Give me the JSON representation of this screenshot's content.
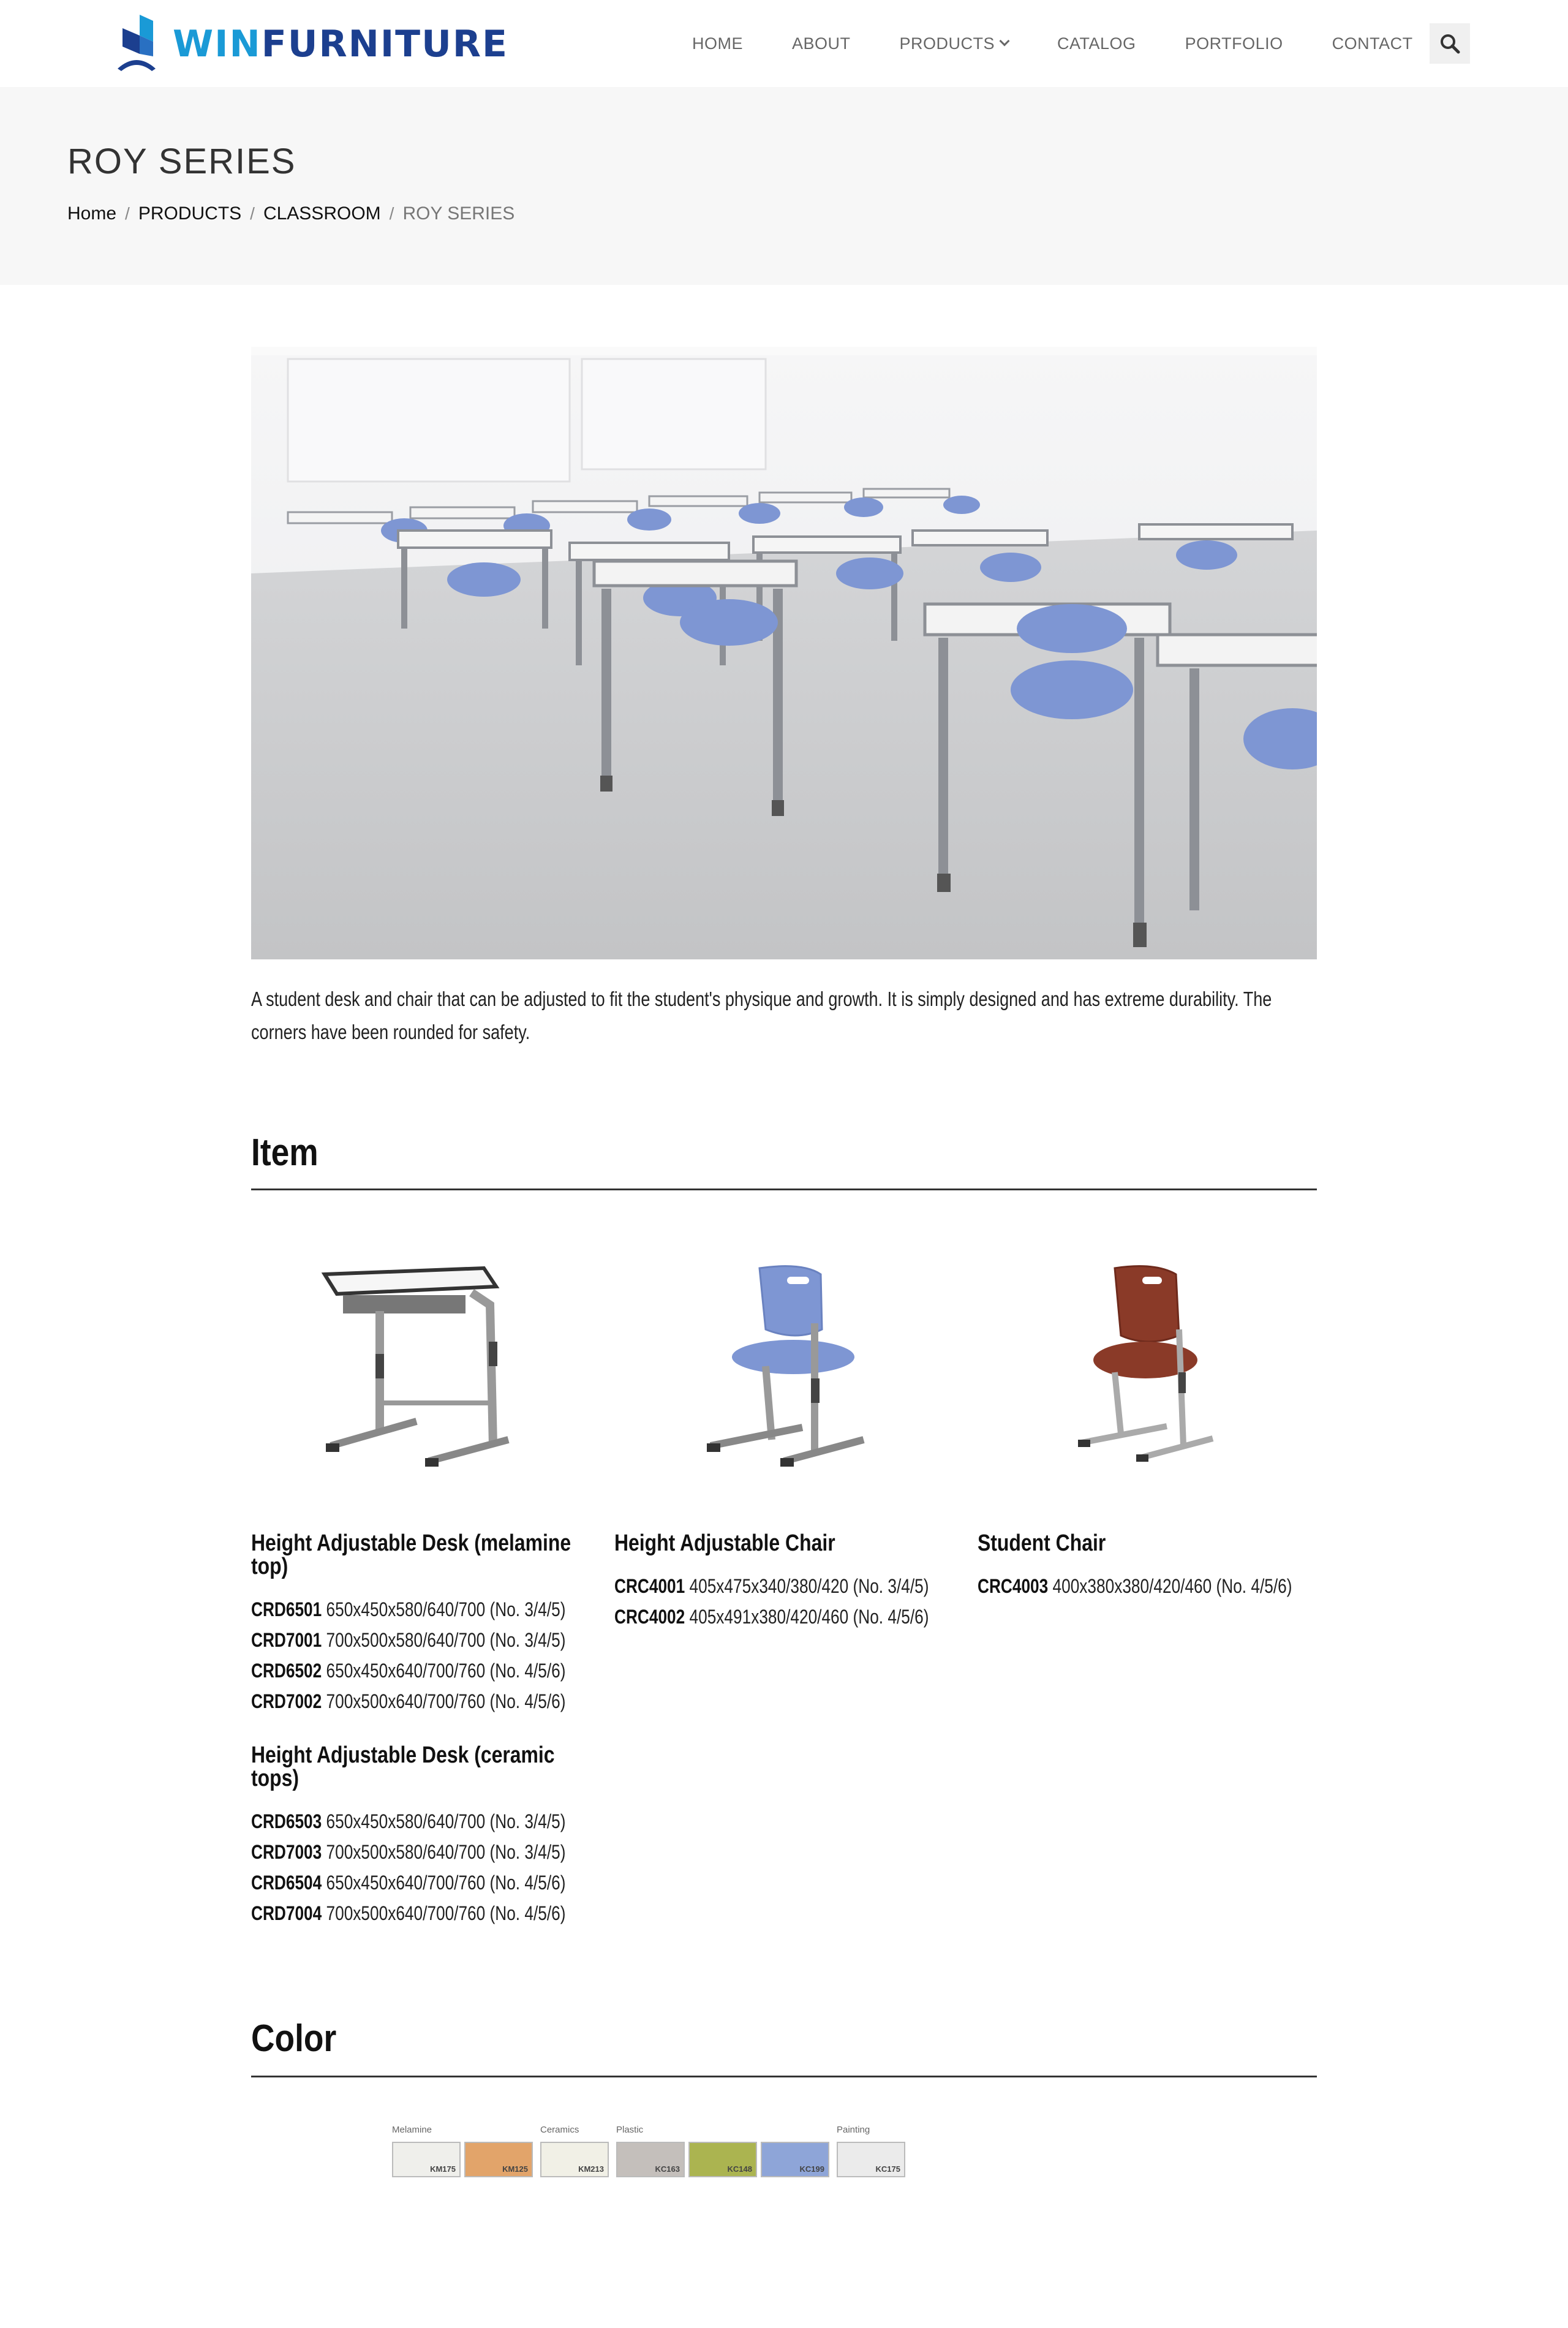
{
  "brand": {
    "name_part1": "WIN",
    "name_part2": "FURNITURE"
  },
  "nav": {
    "items": [
      {
        "label": "HOME"
      },
      {
        "label": "ABOUT"
      },
      {
        "label": "PRODUCTS",
        "has_dropdown": true
      },
      {
        "label": "CATALOG"
      },
      {
        "label": "PORTFOLIO"
      },
      {
        "label": "CONTACT"
      }
    ],
    "search_icon": "search-icon"
  },
  "page": {
    "title": "ROY SERIES",
    "breadcrumb": [
      "Home",
      "PRODUCTS",
      "CLASSROOM",
      "ROY SERIES"
    ]
  },
  "description": "A student desk and chair that can be adjusted to fit the student's physique and growth. It is simply designed and has extreme durability. The corners have been rounded for safety.",
  "items_section": {
    "title": "Item",
    "products": [
      {
        "groups": [
          {
            "name": "Height Adjustable Desk (melamine top)",
            "specs": [
              {
                "code": "CRD6501",
                "detail": "650x450x580/640/700 (No. 3/4/5)"
              },
              {
                "code": "CRD7001",
                "detail": "700x500x580/640/700 (No. 3/4/5)"
              },
              {
                "code": "CRD6502",
                "detail": "650x450x640/700/760 (No. 4/5/6)"
              },
              {
                "code": "CRD7002",
                "detail": "700x500x640/700/760 (No. 4/5/6)"
              }
            ]
          },
          {
            "name": "Height Adjustable Desk (ceramic tops)",
            "specs": [
              {
                "code": "CRD6503",
                "detail": "650x450x580/640/700 (No. 3/4/5)"
              },
              {
                "code": "CRD7003",
                "detail": "700x500x580/640/700 (No. 3/4/5)"
              },
              {
                "code": "CRD6504",
                "detail": "650x450x640/700/760 (No. 4/5/6)"
              },
              {
                "code": "CRD7004",
                "detail": "700x500x640/700/760 (No. 4/5/6)"
              }
            ]
          }
        ]
      },
      {
        "groups": [
          {
            "name": "Height Adjustable Chair",
            "specs": [
              {
                "code": "CRC4001",
                "detail": "405x475x340/380/420 (No. 3/4/5)"
              },
              {
                "code": "CRC4002",
                "detail": "405x491x380/420/460 (No. 4/5/6)"
              }
            ]
          }
        ]
      },
      {
        "groups": [
          {
            "name": "Student Chair",
            "specs": [
              {
                "code": "CRC4003",
                "detail": "400x380x380/420/460 (No. 4/5/6)"
              }
            ]
          }
        ]
      }
    ]
  },
  "color_section": {
    "title": "Color",
    "groups": [
      {
        "label": "Melamine",
        "swatches": [
          {
            "code": "KM175",
            "hex": "#efefeb"
          },
          {
            "code": "KM125",
            "hex": "#e2a46a"
          }
        ]
      },
      {
        "label": "Ceramics",
        "swatches": [
          {
            "code": "KM213",
            "hex": "#f1f0e6"
          }
        ]
      },
      {
        "label": "Plastic",
        "swatches": [
          {
            "code": "KC163",
            "hex": "#c4bfbb"
          },
          {
            "code": "KC148",
            "hex": "#abb450"
          },
          {
            "code": "KC199",
            "hex": "#8ea5d8"
          }
        ]
      },
      {
        "label": "Painting",
        "swatches": [
          {
            "code": "KC175",
            "hex": "#ebebeb"
          }
        ]
      }
    ]
  },
  "colors": {
    "brand_light": "#1a9ad6",
    "brand_dark": "#1c3f8f",
    "chair_blue": "#7e96d3",
    "chair_wood": "#8a3a28"
  }
}
